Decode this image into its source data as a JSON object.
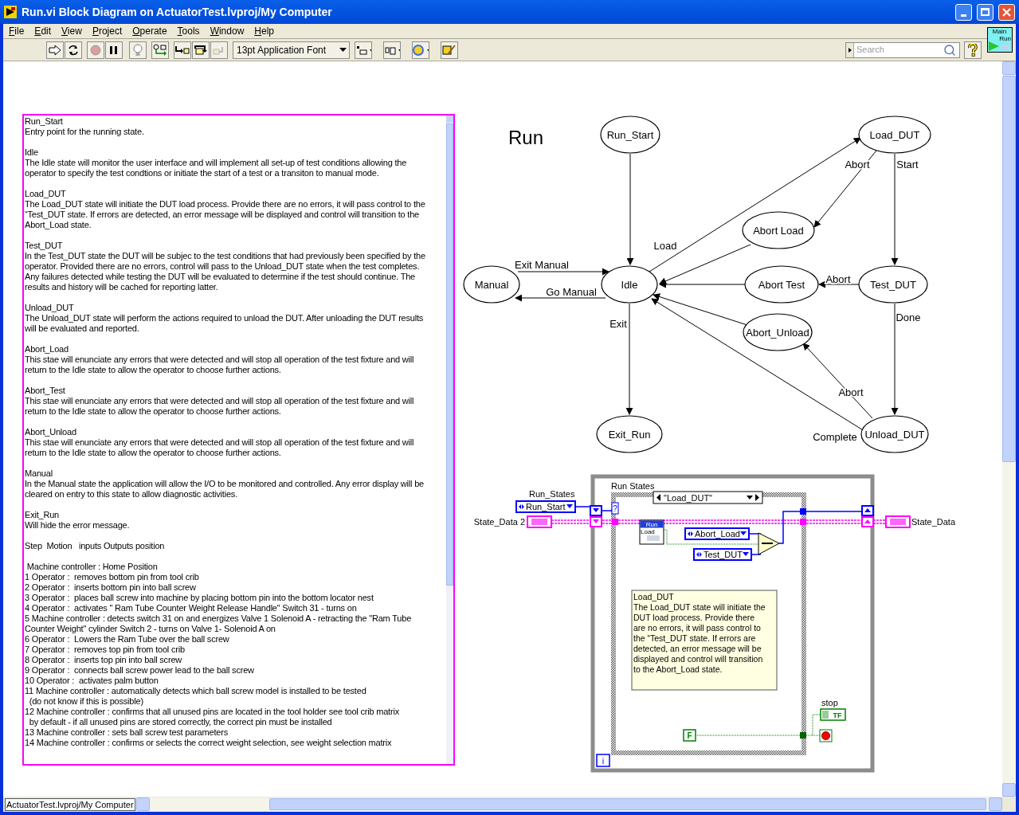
{
  "window": {
    "title": "Run.vi Block Diagram on ActuatorTest.lvproj/My Computer"
  },
  "menu": [
    "File",
    "Edit",
    "View",
    "Project",
    "Operate",
    "Tools",
    "Window",
    "Help"
  ],
  "toolbar": {
    "font": "13pt Application Font",
    "search_placeholder": "Search",
    "vi_icon": [
      "Main",
      "Run"
    ]
  },
  "comment": {
    "blocks": [
      {
        "lines": [
          "Run_Start",
          "Entry point for the running state."
        ]
      },
      {
        "lines": [
          "Idle",
          "The Idle state will monitor the user interface and will implement all set-up of test conditions allowing the",
          "operator to specify the test condtions or initiate the start of a test or a transiton to manual mode."
        ]
      },
      {
        "lines": [
          "Load_DUT",
          "The Load_DUT state will initiate the DUT load process. Provide there are no errors, it will pass control to the",
          "“Test_DUT state. If errors are detected, an error message will be displayed and control will transition to the",
          "Abort_Load state."
        ]
      },
      {
        "lines": [
          "Test_DUT",
          "In the Test_DUT state the DUT will be subjec to the test conditions that had previously been specified by the",
          "operator. Provided there are no errors, control will pass to the Unload_DUT state when the test completes.",
          "Any failures detected while testing the DUT will be evaluated to determine if the test should continue. The",
          "results and history will be cached for reporting latter."
        ]
      },
      {
        "lines": [
          "Unload_DUT",
          "The Unload_DUT state will perform the actions required to unload the DUT. After unloading the DUT results",
          "will be evaluated and reported."
        ]
      },
      {
        "lines": [
          "Abort_Load",
          "This stae will enunciate any errors that were detected and will stop all operation of the test fixture and will",
          "return to the Idle state to allow the operator to choose further actions."
        ]
      },
      {
        "lines": [
          "Abort_Test",
          "This stae will enunciate any errors that were detected and will stop all operation of the test fixture and will",
          "return to the Idle state to allow the operator to choose further actions."
        ]
      },
      {
        "lines": [
          "Abort_Unload",
          "This stae will enunciate any errors that were detected and will stop all operation of the test fixture and will",
          "return to the Idle state to allow the operator to choose further actions."
        ]
      },
      {
        "lines": [
          "Manual",
          "In the Manual state the application will allow the I/O to be monitored and controlled. Any error display will be",
          "cleared on entry to this state to allow diagnostic activities."
        ]
      },
      {
        "lines": [
          "Exit_Run",
          "Will hide the error message."
        ]
      },
      {
        "lines": [
          "Step  Motion   inputs Outputs position"
        ]
      },
      {
        "lines": [
          " Machine controller : Home Position",
          "1 Operator :  removes bottom pin from tool crib",
          "2 Operator :  inserts bottom pin into ball screw",
          "3 Operator :  places ball screw into machine by placing bottom pin into the bottom locator nest",
          "4 Operator :  activates \" Ram Tube Counter Weight Release Handle\" Switch 31 - turns on",
          "5 Machine controller : detects switch 31 on and energizes Valve 1 Solenoid A - retracting the \"Ram Tube",
          "Counter Weight\" cylinder Switch 2 - turns on Valve 1- Solenoid A on",
          "6 Operator :  Lowers the Ram Tube over the ball screw",
          "7 Operator :  removes top pin from tool crib",
          "8 Operator :  inserts top pin into ball screw",
          "9 Operator :  connects ball screw power lead to the ball screw",
          "10 Operator :  activates palm button",
          "11 Machine controller : automatically detects which ball screw model is installed to be tested",
          "  (do not know if this is possible)",
          "12 Machine controller : confirms that all unused pins are located in the tool holder see tool crib matrix",
          "  by default - if all unused pins are stored correctly, the correct pin must be installed",
          "13 Machine controller : sets ball screw test parameters",
          "14 Machine controller : confirms or selects the correct weight selection, see weight selection matrix"
        ]
      }
    ]
  },
  "state_diagram": {
    "title": "Run",
    "states": [
      "Run_Start",
      "Load_DUT",
      "Abort Load",
      "Manual",
      "Idle",
      "Abort Test",
      "Test_DUT",
      "Abort_Unload",
      "Exit_Run",
      "Unload_DUT"
    ],
    "transition_labels": [
      "Abort",
      "Start",
      "Load",
      "Exit Manual",
      "Go Manual",
      "Abort",
      "Exit",
      "Done",
      "Abort",
      "Complete"
    ]
  },
  "block_diagram": {
    "case_label": "Run States",
    "selector": "\"Load_DUT\"",
    "selector_terminal": "?",
    "enum_control": {
      "label": "Run_States",
      "value": "Run_Start"
    },
    "cluster_in": "State_Data 2",
    "cluster_out": "State_Data",
    "subvi": [
      "Run",
      "Load"
    ],
    "enum_constants": [
      "Abort_Load",
      "Test_DUT"
    ],
    "comment": [
      "Load_DUT",
      "The Load_DUT state will initiate the",
      "DUT load process. Provide there",
      "are no errors, it will pass control to",
      "the “Test_DUT state. If errors are",
      "detected, an error message will be",
      "displayed and control will transition",
      "to the Abort_Load state."
    ],
    "stop": {
      "label": "stop",
      "indicator": "TF"
    },
    "false_constant": "F",
    "iteration": "i"
  },
  "status_bar": {
    "path": "ActuatorTest.lvproj/My Computer"
  }
}
